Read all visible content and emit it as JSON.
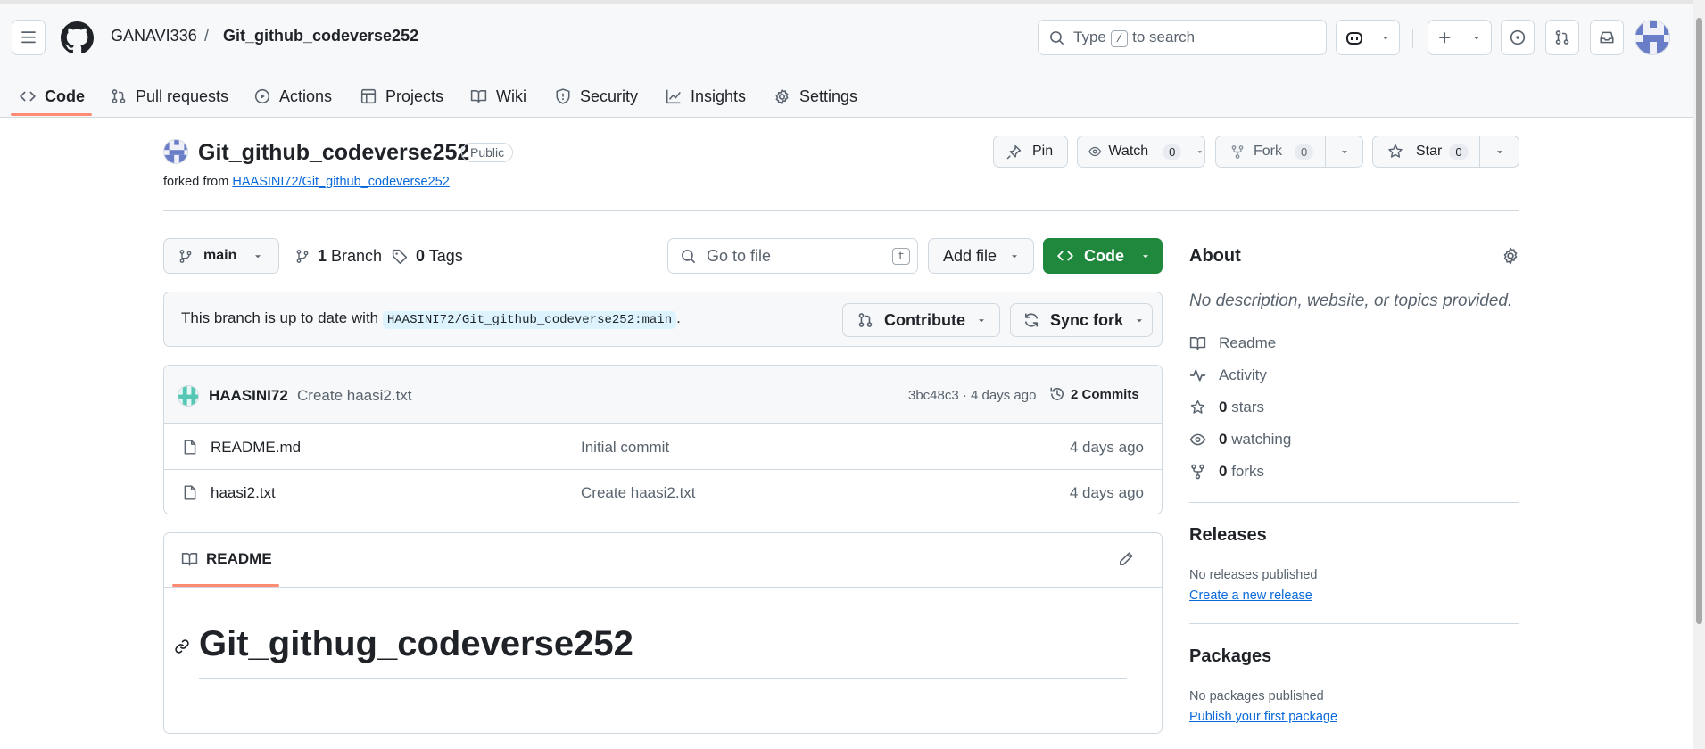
{
  "header": {
    "owner": "GANAVI336",
    "separator": "/",
    "repo": "Git_github_codeverse252",
    "search_before": "Type",
    "search_key": "/",
    "search_after": "to search"
  },
  "tabs": [
    {
      "label": "Code",
      "icon": "code-icon"
    },
    {
      "label": "Pull requests",
      "icon": "git-pull-request-icon"
    },
    {
      "label": "Actions",
      "icon": "play-icon"
    },
    {
      "label": "Projects",
      "icon": "table-icon"
    },
    {
      "label": "Wiki",
      "icon": "book-icon"
    },
    {
      "label": "Security",
      "icon": "shield-icon"
    },
    {
      "label": "Insights",
      "icon": "graph-icon"
    },
    {
      "label": "Settings",
      "icon": "gear-icon"
    }
  ],
  "repo": {
    "name": "Git_github_codeverse252",
    "visibility": "Public",
    "forked_from_prefix": "forked from",
    "forked_from": "HAASINI72/Git_github_codeverse252",
    "pin": "Pin",
    "watch": "Watch",
    "watch_count": "0",
    "fork": "Fork",
    "fork_count": "0",
    "star": "Star",
    "star_count": "0"
  },
  "toolbar": {
    "branch": "main",
    "branches_count": "1",
    "branches_label": "Branch",
    "tags_count": "0",
    "tags_label": "Tags",
    "goto_placeholder": "Go to file",
    "goto_key": "t",
    "add_file": "Add file",
    "code": "Code"
  },
  "sync": {
    "text": "This branch is up to date with",
    "ref": "HAASINI72/Git_github_codeverse252:main",
    "period": ".",
    "contribute": "Contribute",
    "sync_fork": "Sync fork"
  },
  "commit": {
    "author": "HAASINI72",
    "message": "Create haasi2.txt",
    "meta": "3bc48c3 · 4 days ago",
    "commits": "2 Commits"
  },
  "files": [
    {
      "name": "README.md",
      "message": "Initial commit",
      "age": "4 days ago"
    },
    {
      "name": "haasi2.txt",
      "message": "Create haasi2.txt",
      "age": "4 days ago"
    }
  ],
  "readme": {
    "tab": "README",
    "heading": "Git_githug_codeverse252"
  },
  "about": {
    "title": "About",
    "description": "No description, website, or topics provided.",
    "readme": "Readme",
    "activity": "Activity",
    "stars_count": "0",
    "stars_label": "stars",
    "watching_count": "0",
    "watching_label": "watching",
    "forks_count": "0",
    "forks_label": "forks"
  },
  "releases": {
    "title": "Releases",
    "none": "No releases published",
    "create": "Create a new release"
  },
  "packages": {
    "title": "Packages",
    "none": "No packages published",
    "publish": "Publish your first package"
  },
  "colors": {
    "accent": "#fd8c73",
    "link": "#0969da",
    "primary_button": "#1f883d"
  }
}
